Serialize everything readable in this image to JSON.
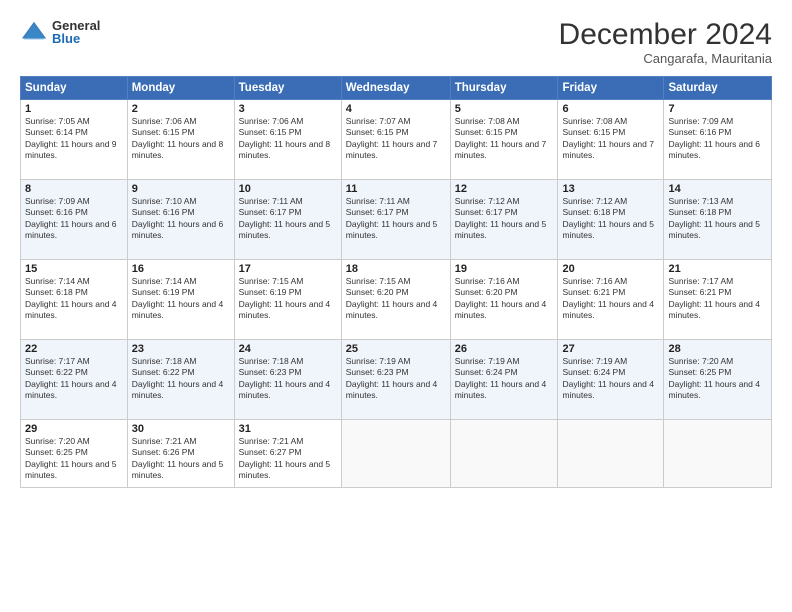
{
  "logo": {
    "general": "General",
    "blue": "Blue"
  },
  "title": "December 2024",
  "subtitle": "Cangarafa, Mauritania",
  "header_days": [
    "Sunday",
    "Monday",
    "Tuesday",
    "Wednesday",
    "Thursday",
    "Friday",
    "Saturday"
  ],
  "weeks": [
    [
      {
        "day": "1",
        "sunrise": "7:05 AM",
        "sunset": "6:14 PM",
        "daylight": "11 hours and 9 minutes."
      },
      {
        "day": "2",
        "sunrise": "7:06 AM",
        "sunset": "6:15 PM",
        "daylight": "11 hours and 8 minutes."
      },
      {
        "day": "3",
        "sunrise": "7:06 AM",
        "sunset": "6:15 PM",
        "daylight": "11 hours and 8 minutes."
      },
      {
        "day": "4",
        "sunrise": "7:07 AM",
        "sunset": "6:15 PM",
        "daylight": "11 hours and 7 minutes."
      },
      {
        "day": "5",
        "sunrise": "7:08 AM",
        "sunset": "6:15 PM",
        "daylight": "11 hours and 7 minutes."
      },
      {
        "day": "6",
        "sunrise": "7:08 AM",
        "sunset": "6:15 PM",
        "daylight": "11 hours and 7 minutes."
      },
      {
        "day": "7",
        "sunrise": "7:09 AM",
        "sunset": "6:16 PM",
        "daylight": "11 hours and 6 minutes."
      }
    ],
    [
      {
        "day": "8",
        "sunrise": "7:09 AM",
        "sunset": "6:16 PM",
        "daylight": "11 hours and 6 minutes."
      },
      {
        "day": "9",
        "sunrise": "7:10 AM",
        "sunset": "6:16 PM",
        "daylight": "11 hours and 6 minutes."
      },
      {
        "day": "10",
        "sunrise": "7:11 AM",
        "sunset": "6:17 PM",
        "daylight": "11 hours and 5 minutes."
      },
      {
        "day": "11",
        "sunrise": "7:11 AM",
        "sunset": "6:17 PM",
        "daylight": "11 hours and 5 minutes."
      },
      {
        "day": "12",
        "sunrise": "7:12 AM",
        "sunset": "6:17 PM",
        "daylight": "11 hours and 5 minutes."
      },
      {
        "day": "13",
        "sunrise": "7:12 AM",
        "sunset": "6:18 PM",
        "daylight": "11 hours and 5 minutes."
      },
      {
        "day": "14",
        "sunrise": "7:13 AM",
        "sunset": "6:18 PM",
        "daylight": "11 hours and 5 minutes."
      }
    ],
    [
      {
        "day": "15",
        "sunrise": "7:14 AM",
        "sunset": "6:18 PM",
        "daylight": "11 hours and 4 minutes."
      },
      {
        "day": "16",
        "sunrise": "7:14 AM",
        "sunset": "6:19 PM",
        "daylight": "11 hours and 4 minutes."
      },
      {
        "day": "17",
        "sunrise": "7:15 AM",
        "sunset": "6:19 PM",
        "daylight": "11 hours and 4 minutes."
      },
      {
        "day": "18",
        "sunrise": "7:15 AM",
        "sunset": "6:20 PM",
        "daylight": "11 hours and 4 minutes."
      },
      {
        "day": "19",
        "sunrise": "7:16 AM",
        "sunset": "6:20 PM",
        "daylight": "11 hours and 4 minutes."
      },
      {
        "day": "20",
        "sunrise": "7:16 AM",
        "sunset": "6:21 PM",
        "daylight": "11 hours and 4 minutes."
      },
      {
        "day": "21",
        "sunrise": "7:17 AM",
        "sunset": "6:21 PM",
        "daylight": "11 hours and 4 minutes."
      }
    ],
    [
      {
        "day": "22",
        "sunrise": "7:17 AM",
        "sunset": "6:22 PM",
        "daylight": "11 hours and 4 minutes."
      },
      {
        "day": "23",
        "sunrise": "7:18 AM",
        "sunset": "6:22 PM",
        "daylight": "11 hours and 4 minutes."
      },
      {
        "day": "24",
        "sunrise": "7:18 AM",
        "sunset": "6:23 PM",
        "daylight": "11 hours and 4 minutes."
      },
      {
        "day": "25",
        "sunrise": "7:19 AM",
        "sunset": "6:23 PM",
        "daylight": "11 hours and 4 minutes."
      },
      {
        "day": "26",
        "sunrise": "7:19 AM",
        "sunset": "6:24 PM",
        "daylight": "11 hours and 4 minutes."
      },
      {
        "day": "27",
        "sunrise": "7:19 AM",
        "sunset": "6:24 PM",
        "daylight": "11 hours and 4 minutes."
      },
      {
        "day": "28",
        "sunrise": "7:20 AM",
        "sunset": "6:25 PM",
        "daylight": "11 hours and 4 minutes."
      }
    ],
    [
      {
        "day": "29",
        "sunrise": "7:20 AM",
        "sunset": "6:25 PM",
        "daylight": "11 hours and 5 minutes."
      },
      {
        "day": "30",
        "sunrise": "7:21 AM",
        "sunset": "6:26 PM",
        "daylight": "11 hours and 5 minutes."
      },
      {
        "day": "31",
        "sunrise": "7:21 AM",
        "sunset": "6:27 PM",
        "daylight": "11 hours and 5 minutes."
      },
      null,
      null,
      null,
      null
    ]
  ],
  "labels": {
    "sunrise": "Sunrise:",
    "sunset": "Sunset:",
    "daylight": "Daylight:"
  }
}
